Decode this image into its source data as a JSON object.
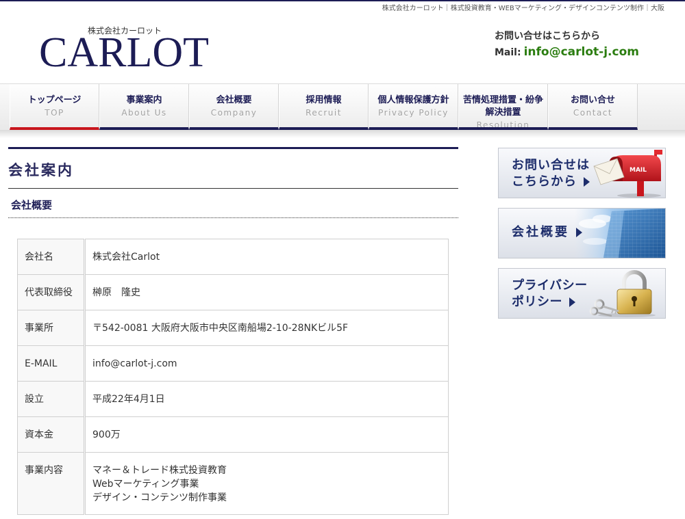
{
  "colors": {
    "navy": "#1c1c55",
    "active_red": "#c8161d",
    "mail_green": "#2b7d10"
  },
  "header": {
    "tagline": "株式会社カーロット｜株式投資教育・WEBマーケティング・デザインコンテンツ制作｜大阪",
    "logo_company": "株式会社カーロット",
    "logo_text": "CARLOT",
    "contact_prompt": "お問い合せはこちらから",
    "mail_label": "Mail:",
    "mail_address": "info@carlot-j.com"
  },
  "nav": {
    "items": [
      {
        "label": "トップページ",
        "sub": "TOP",
        "active": true
      },
      {
        "label": "事業案内",
        "sub": "About Us",
        "active": false
      },
      {
        "label": "会社概要",
        "sub": "Company",
        "active": false
      },
      {
        "label": "採用情報",
        "sub": "Recruit",
        "active": false
      },
      {
        "label": "個人情報保護方針",
        "sub": "Privacy Policy",
        "active": false
      },
      {
        "label": "苦情処理措置・紛争解決措置",
        "sub": "Resolution",
        "active": false
      },
      {
        "label": "お問い合せ",
        "sub": "Contact",
        "active": false
      }
    ]
  },
  "main": {
    "page_title": "会社案内",
    "section_title": "会社概要",
    "company_table": [
      {
        "label": "会社名",
        "lines": [
          "株式会社Carlot"
        ]
      },
      {
        "label": "代表取締役",
        "lines": [
          "榊原　隆史"
        ]
      },
      {
        "label": "事業所",
        "lines": [
          "〒542-0081 大阪府大阪市中央区南船場2-10-28NKビル5F"
        ]
      },
      {
        "label": "E-MAIL",
        "lines": [
          "info@carlot-j.com"
        ]
      },
      {
        "label": "設立",
        "lines": [
          "平成22年4月1日"
        ]
      },
      {
        "label": "資本金",
        "lines": [
          "900万"
        ]
      },
      {
        "label": "事業内容",
        "lines": [
          "マネー＆トレード株式投資教育",
          "Webマーケティング事業",
          "デザイン・コンテンツ制作事業"
        ]
      }
    ]
  },
  "sidebar": {
    "banners": [
      {
        "lines": [
          "お問い合せは",
          "こちらから"
        ],
        "icon": "mailbox-icon",
        "mailbox_text": "MAIL",
        "arrow_icon": "arrow-right-icon"
      },
      {
        "lines": [
          "会社概要"
        ],
        "icon": "office-building-icon",
        "arrow_icon": "arrow-right-icon"
      },
      {
        "lines": [
          "プライバシー",
          "ポリシー"
        ],
        "icon": "padlock-and-keys-icon",
        "arrow_icon": "arrow-right-icon"
      }
    ]
  }
}
